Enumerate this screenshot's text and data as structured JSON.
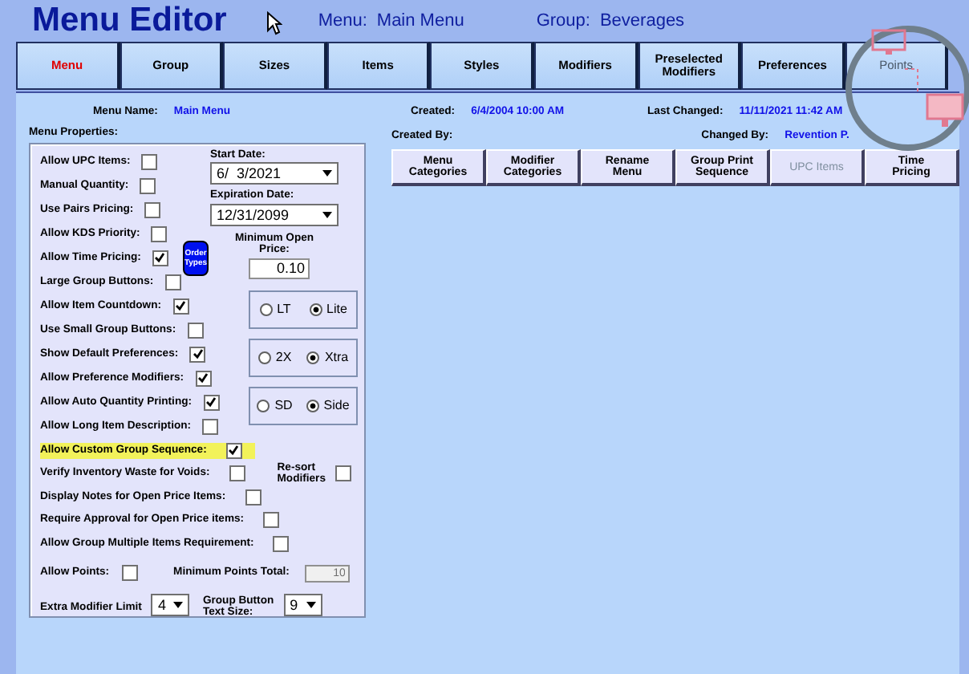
{
  "header": {
    "title": "Menu Editor",
    "menu_label": "Menu:",
    "menu_value": "Main Menu",
    "group_label": "Group:",
    "group_value": "Beverages"
  },
  "tabs": [
    {
      "label": "Menu",
      "selected": true,
      "disabled": false
    },
    {
      "label": "Group",
      "selected": false,
      "disabled": false
    },
    {
      "label": "Sizes",
      "selected": false,
      "disabled": false
    },
    {
      "label": "Items",
      "selected": false,
      "disabled": false
    },
    {
      "label": "Styles",
      "selected": false,
      "disabled": false
    },
    {
      "label": "Modifiers",
      "selected": false,
      "disabled": false
    },
    {
      "label": "Preselected\nModifiers",
      "selected": false,
      "disabled": false
    },
    {
      "label": "Preferences",
      "selected": false,
      "disabled": false
    },
    {
      "label": "Points",
      "selected": false,
      "disabled": true
    }
  ],
  "info": {
    "menu_name_label": "Menu Name:",
    "menu_name": "Main Menu",
    "created_label": "Created:",
    "created": "6/4/2004 10:00 AM",
    "last_changed_label": "Last Changed:",
    "last_changed": "11/11/2021 11:42 AM",
    "created_by_label": "Created By:",
    "changed_by_label": "Changed By:",
    "changed_by": "Revention P."
  },
  "properties_title": "Menu Properties:",
  "options_top": [
    {
      "label": "Allow UPC Items:",
      "checked": false
    },
    {
      "label": "Manual Quantity:",
      "checked": false
    },
    {
      "label": "Use Pairs Pricing:",
      "checked": false
    },
    {
      "label": "Allow KDS Priority:",
      "checked": false
    },
    {
      "label": "Allow Time Pricing:",
      "checked": true,
      "button": "Order\nTypes"
    },
    {
      "label": "Large Group Buttons:",
      "checked": false
    },
    {
      "label": "Allow Item Countdown:",
      "checked": true
    },
    {
      "label": "Use Small Group Buttons:",
      "checked": false
    },
    {
      "label": "Show Default Preferences:",
      "checked": true
    },
    {
      "label": "Allow Preference Modifiers:",
      "checked": true
    },
    {
      "label": "Allow Auto Quantity Printing:",
      "checked": true
    },
    {
      "label": "Allow Long Item Description:",
      "checked": false
    }
  ],
  "start_date": {
    "label": "Start Date:",
    "value": "6/  3/2021"
  },
  "expiration_date": {
    "label": "Expiration Date:",
    "value": "12/31/2099"
  },
  "min_open_price": {
    "label": "Minimum Open\nPrice:",
    "value": "0.10"
  },
  "radio_groups": [
    {
      "options": [
        {
          "label": "LT",
          "selected": false
        },
        {
          "label": "Lite",
          "selected": true
        }
      ]
    },
    {
      "options": [
        {
          "label": "2X",
          "selected": false
        },
        {
          "label": "Xtra",
          "selected": true
        }
      ]
    },
    {
      "options": [
        {
          "label": "SD",
          "selected": false
        },
        {
          "label": "Side",
          "selected": true
        }
      ]
    }
  ],
  "options_bottom": [
    {
      "label": "Allow Custom Group Sequence:",
      "checked": true,
      "highlighted": true
    },
    {
      "label": "Verify Inventory Waste for Voids:",
      "checked": false,
      "highlighted": false,
      "side_option": {
        "label": "Re-sort\nModifiers",
        "checked": false
      }
    },
    {
      "label": "Display Notes for Open Price Items:",
      "checked": false,
      "highlighted": false
    },
    {
      "label": "Require Approval for Open Price items:",
      "checked": false,
      "highlighted": false
    },
    {
      "label": "Allow Group Multiple Items Requirement:",
      "checked": false,
      "highlighted": false
    }
  ],
  "allow_points": {
    "label": "Allow Points:",
    "checked": false
  },
  "min_points_total": {
    "label": "Minimum Points Total:",
    "value": "10",
    "disabled": true
  },
  "extra_modifier_limit": {
    "label": "Extra Modifier Limit",
    "value": "4"
  },
  "group_button_text_size": {
    "label": "Group Button\nText Size:",
    "value": "9"
  },
  "action_buttons": [
    {
      "label": "Menu\nCategories",
      "disabled": false
    },
    {
      "label": "Modifier\nCategories",
      "disabled": false
    },
    {
      "label": "Rename\nMenu",
      "disabled": false
    },
    {
      "label": "Group Print\nSequence",
      "disabled": false
    },
    {
      "label": "UPC Items",
      "disabled": true
    },
    {
      "label": "Time\nPricing",
      "disabled": false
    }
  ]
}
